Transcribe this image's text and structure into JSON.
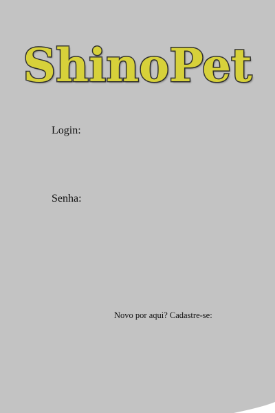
{
  "logo": {
    "text": "ShinoPet"
  },
  "form": {
    "login_label": "Login:",
    "login_value": "",
    "senha_label": "Senha:",
    "senha_value": ""
  },
  "signup": {
    "text": "Novo por aqui? Cadastre-se:"
  },
  "colors": {
    "background": "#c3c3c3",
    "logo_fill": "#d7d13a",
    "logo_outline": "#3d3d3d",
    "text": "#111111"
  }
}
